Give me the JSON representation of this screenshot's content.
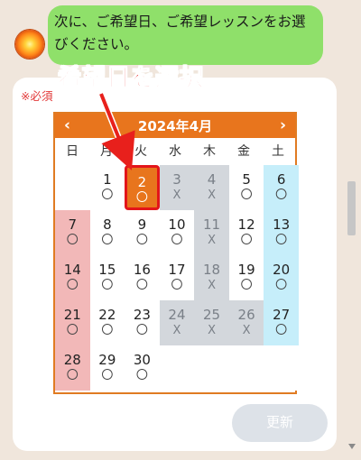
{
  "bubble": {
    "line1": "次に、ご希望日、ご希望レッスンをお選",
    "line2": "びください。"
  },
  "required_label": "※必須",
  "annotation": "希望日を選択",
  "calendar": {
    "title": "2024年4月",
    "prev_icon": "‹",
    "next_icon": "›",
    "weekdays": [
      "日",
      "月",
      "火",
      "水",
      "木",
      "金",
      "土"
    ],
    "weeks": [
      [
        {
          "day": "",
          "mark": ""
        },
        {
          "day": "1",
          "mark": "〇"
        },
        {
          "day": "2",
          "mark": "〇"
        },
        {
          "day": "3",
          "mark": "X"
        },
        {
          "day": "4",
          "mark": "X"
        },
        {
          "day": "5",
          "mark": "〇"
        },
        {
          "day": "6",
          "mark": "〇"
        }
      ],
      [
        {
          "day": "7",
          "mark": "〇"
        },
        {
          "day": "8",
          "mark": "〇"
        },
        {
          "day": "9",
          "mark": "〇"
        },
        {
          "day": "10",
          "mark": "〇"
        },
        {
          "day": "11",
          "mark": "X"
        },
        {
          "day": "12",
          "mark": "〇"
        },
        {
          "day": "13",
          "mark": "〇"
        }
      ],
      [
        {
          "day": "14",
          "mark": "〇"
        },
        {
          "day": "15",
          "mark": "〇"
        },
        {
          "day": "16",
          "mark": "〇"
        },
        {
          "day": "17",
          "mark": "〇"
        },
        {
          "day": "18",
          "mark": "X"
        },
        {
          "day": "19",
          "mark": "〇"
        },
        {
          "day": "20",
          "mark": "〇"
        }
      ],
      [
        {
          "day": "21",
          "mark": "〇"
        },
        {
          "day": "22",
          "mark": "〇"
        },
        {
          "day": "23",
          "mark": "〇"
        },
        {
          "day": "24",
          "mark": "X"
        },
        {
          "day": "25",
          "mark": "X"
        },
        {
          "day": "26",
          "mark": "X"
        },
        {
          "day": "27",
          "mark": "〇"
        }
      ],
      [
        {
          "day": "28",
          "mark": "〇"
        },
        {
          "day": "29",
          "mark": "〇"
        },
        {
          "day": "30",
          "mark": "〇"
        },
        {
          "day": "",
          "mark": ""
        },
        {
          "day": "",
          "mark": ""
        },
        {
          "day": "",
          "mark": ""
        },
        {
          "day": "",
          "mark": ""
        }
      ]
    ],
    "selected_day": "2",
    "colors": {
      "header": "#e8751d",
      "sunday": "#f2b8b8",
      "saturday": "#c6eefa",
      "closed": "#d3d7dc",
      "selected_border": "#e3151a"
    }
  },
  "update_button": "更新"
}
